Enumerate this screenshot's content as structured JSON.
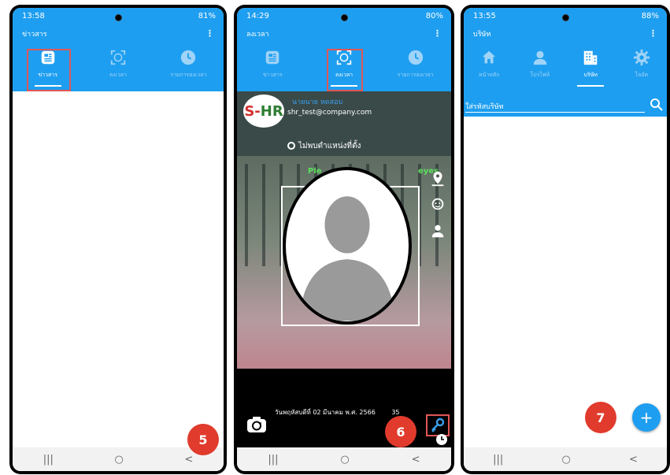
{
  "colors": {
    "primary": "#1e9ef0",
    "tab_inactive": "#9fd3f7",
    "highlight": "#e05656",
    "step_badge": "#e03b2c"
  },
  "phone1": {
    "status": {
      "time": "13:58",
      "right": "81%"
    },
    "title": "ข่าวสาร",
    "tabs": [
      {
        "label": "ข่าวสาร",
        "icon": "news-icon",
        "active": true
      },
      {
        "label": "ลงเวลา",
        "icon": "face-scan-icon",
        "active": false
      },
      {
        "label": "รายการลงเวลา",
        "icon": "clock-icon",
        "active": false
      }
    ],
    "step": "5",
    "nav": {
      "recent": "|||",
      "home": "○",
      "back": "<"
    }
  },
  "phone2": {
    "status": {
      "time": "14:29",
      "right": "80%"
    },
    "title": "ลงเวลา",
    "tabs": [
      {
        "label": "ข่าวสาร",
        "icon": "news-icon",
        "active": false
      },
      {
        "label": "ลงเวลา",
        "icon": "face-scan-icon",
        "active": true
      },
      {
        "label": "รายการลงเวลา",
        "icon": "clock-icon",
        "active": false
      }
    ],
    "logo": {
      "left": "S-",
      "right": "HR"
    },
    "user_name": "นายนาย หดสอบ",
    "user_email": "shr_test@company.com",
    "location_status": "ไม่พบตำแหน่งที่ตั้ง",
    "prompt_left": "Ple",
    "prompt_right": "eyes",
    "datetime": "วันพฤหัสบดีที่ 02 มีนาคม พ.ศ. 2566",
    "datetime_tail": "35",
    "step": "6",
    "nav": {
      "recent": "|||",
      "home": "○",
      "back": "<"
    }
  },
  "phone3": {
    "status": {
      "time": "13:55",
      "right": "88%"
    },
    "title": "บริษัท",
    "tabs": [
      {
        "label": "หน้าหลัก",
        "icon": "home-icon",
        "active": false
      },
      {
        "label": "โปรไฟล์",
        "icon": "profile-icon",
        "active": false
      },
      {
        "label": "บริษัท",
        "icon": "company-icon",
        "active": true
      },
      {
        "label": "โลอัต",
        "icon": "gear-icon",
        "active": false
      }
    ],
    "search_placeholder": "ใส่รหัสบริษัท",
    "fab_label": "+",
    "step": "7",
    "nav": {
      "recent": "|||",
      "home": "○",
      "back": "<"
    }
  }
}
